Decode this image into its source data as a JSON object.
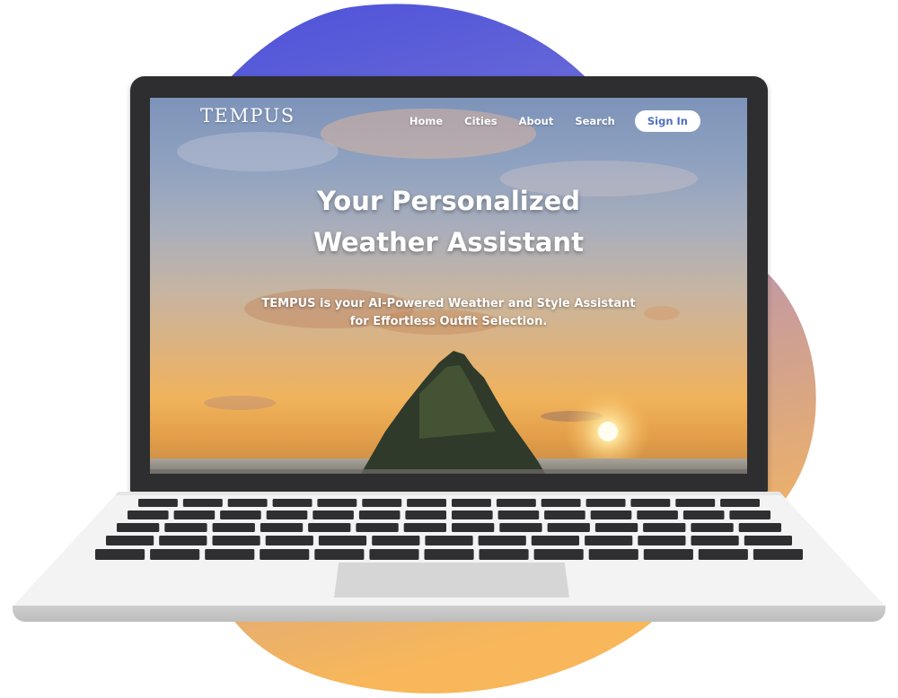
{
  "website": {
    "logo": "TEMPUS",
    "nav": {
      "home": "Home",
      "cities": "Cities",
      "about": "About",
      "search": "Search",
      "sign_in": "Sign In"
    },
    "hero": {
      "title_line1": "Your Personalized",
      "title_line2": "Weather Assistant",
      "subtitle_line1": "TEMPUS is your AI-Powered Weather and Style Assistant",
      "subtitle_line2": "for Effortless Outfit Selection."
    }
  },
  "colors": {
    "blob_top": "#4a4fd9",
    "blob_bottom": "#f7b75a",
    "laptop_bezel": "#2e2e30",
    "sign_in_text": "#4f6fbf"
  },
  "icons": {
    "background_image": "sunset-island-photo",
    "decoration": "gradient-blob-shape"
  }
}
